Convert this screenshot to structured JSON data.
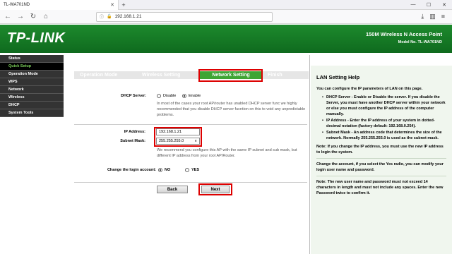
{
  "browser": {
    "tab_title": "TL-WA701ND",
    "tab_close": "✕",
    "new_tab": "+",
    "window_controls": [
      "—",
      "☐",
      "✕"
    ],
    "url": "192.168.1.21",
    "nav_icons": [
      "back-icon",
      "forward-icon",
      "reload-icon",
      "home-icon"
    ],
    "right_icons": [
      "download-icon",
      "library-icon",
      "menu-icon"
    ]
  },
  "header": {
    "logo": "TP-LINK",
    "product": "150M Wireless N Access Point",
    "model": "Model No. TL-WA701ND"
  },
  "menu": {
    "items": [
      {
        "label": "Status",
        "active": false
      },
      {
        "label": "Quick Setup",
        "active": true
      },
      {
        "label": "Operation Mode",
        "active": false
      },
      {
        "label": "WPS",
        "active": false
      },
      {
        "label": "Network",
        "active": false
      },
      {
        "label": "Wireless",
        "active": false
      },
      {
        "label": "DHCP",
        "active": false
      },
      {
        "label": "System Tools",
        "active": false
      }
    ]
  },
  "steps": [
    "Operation Mode",
    "Wireless Setting",
    "Network Setting",
    "Finish"
  ],
  "form": {
    "dhcp_label": "DHCP Server:",
    "dhcp_disable": "Disable",
    "dhcp_enable": "Enable",
    "dhcp_note": "In most of the cases your root AP/router has unabled DHCP server func we highly recommended that you disable DHCP server fucntion on this to void any unpredictable problems.",
    "ip_label": "IP Address:",
    "ip_value": "192.168.1.21",
    "mask_label": "Subnet Mask:",
    "mask_value": "255.255.255.0",
    "ip_note": "We recommend you configure this AP with the same IP subnet and sub mask, but different IP address from your root AP/Router.",
    "login_label": "Change the login account:",
    "login_no": "NO",
    "login_yes": "YES",
    "back": "Back",
    "next": "Next"
  },
  "help": {
    "title": "LAN Setting Help",
    "intro": "You can configure the IP parameters of LAN on this page.",
    "bullets": [
      "DHCP Server - Enable or Disable the server. If you disable the Server, you must have another DHCP server within your network or else you must configure the IP address of the computer manually.",
      "IP Address - Enter the IP address of your system in dotted-decimal notation (factory default: 192.168.0.254).",
      "Subnet Mask - An address code that determines the size of the network. Normally 255.255.255.0 is used as the subnet mask."
    ],
    "note1": "Note: If you change the IP address, you must use the new IP address to login the system.",
    "change": "Change the account, if you select the Yes radio, you can modify your login user name and password.",
    "note2": "Note: The new user name and password must not exceed 14 characters in length and must not include any spaces. Enter the new Password twice to confirm it."
  },
  "colors": {
    "header_green": "#1d8a2d",
    "step_active": "#3fa534",
    "highlight_red": "#dd0000",
    "menu_active": "#7dd35a"
  }
}
